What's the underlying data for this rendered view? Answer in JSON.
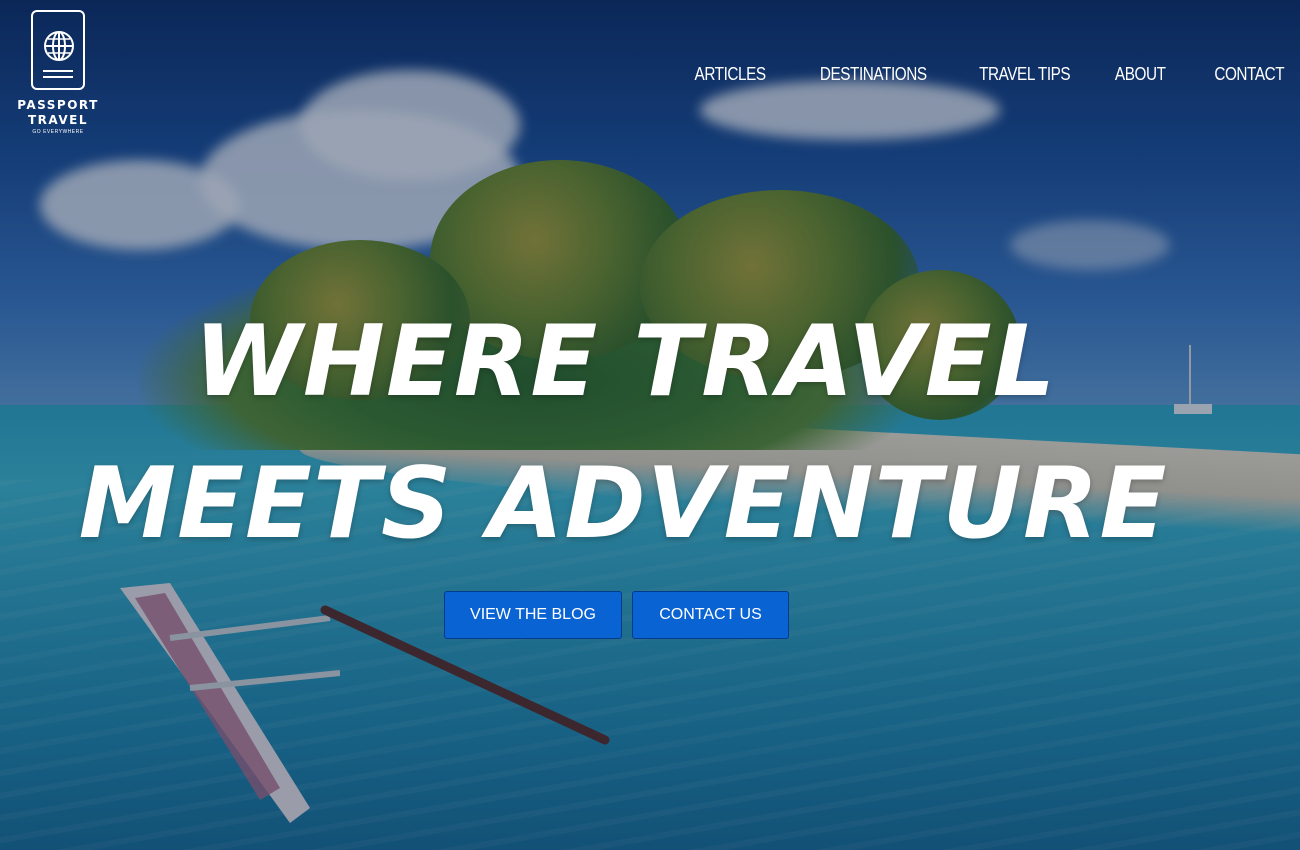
{
  "logo": {
    "brand_line1": "PASSPORT",
    "brand_line2": "TRAVEL",
    "tagline": "GO EVERYWHERE",
    "icon": "passport-globe-icon"
  },
  "nav": {
    "items": [
      "ARTICLES",
      "DESTINATIONS",
      "TRAVEL TIPS",
      "ABOUT",
      "CONTACT"
    ]
  },
  "hero": {
    "headline_line1": "WHERE TRAVEL",
    "headline_line2": "MEETS ADVENTURE",
    "primary_button": "VIEW THE BLOG",
    "secondary_button": "CONTACT US"
  },
  "colors": {
    "button_bg": "#0a63d3",
    "text": "#ffffff"
  }
}
